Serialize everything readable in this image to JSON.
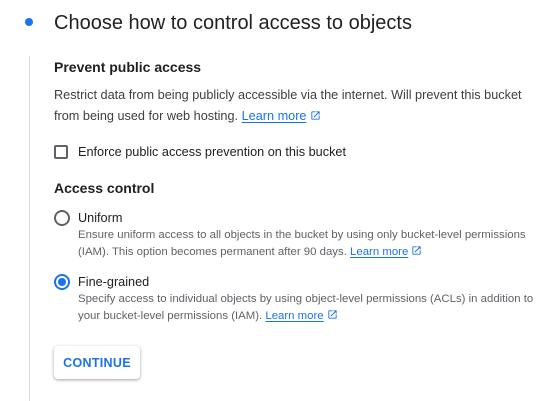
{
  "step": {
    "title": "Choose how to control access to objects"
  },
  "prevent_public_access": {
    "heading": "Prevent public access",
    "description": "Restrict data from being publicly accessible via the internet. Will prevent this bucket from being used for web hosting.",
    "learn_more": "Learn more",
    "checkbox_label": "Enforce public access prevention on this bucket",
    "checkbox_checked": false
  },
  "access_control": {
    "heading": "Access control",
    "options": [
      {
        "label": "Uniform",
        "description": "Ensure uniform access to all objects in the bucket by using only bucket-level permissions (IAM). This option becomes permanent after 90 days.",
        "learn_more": "Learn more",
        "selected": false
      },
      {
        "label": "Fine-grained",
        "description": "Specify access to individual objects by using object-level permissions (ACLs) in addition to your bucket-level permissions (IAM).",
        "learn_more": "Learn more",
        "selected": true
      }
    ]
  },
  "actions": {
    "continue_label": "CONTINUE"
  },
  "colors": {
    "accent": "#1a73e8",
    "text_primary": "#202124",
    "text_secondary": "#5f6368",
    "divider": "#dadce0"
  },
  "icons": {
    "external_link": "open-in-new-icon",
    "step_marker": "step-dot-icon"
  }
}
